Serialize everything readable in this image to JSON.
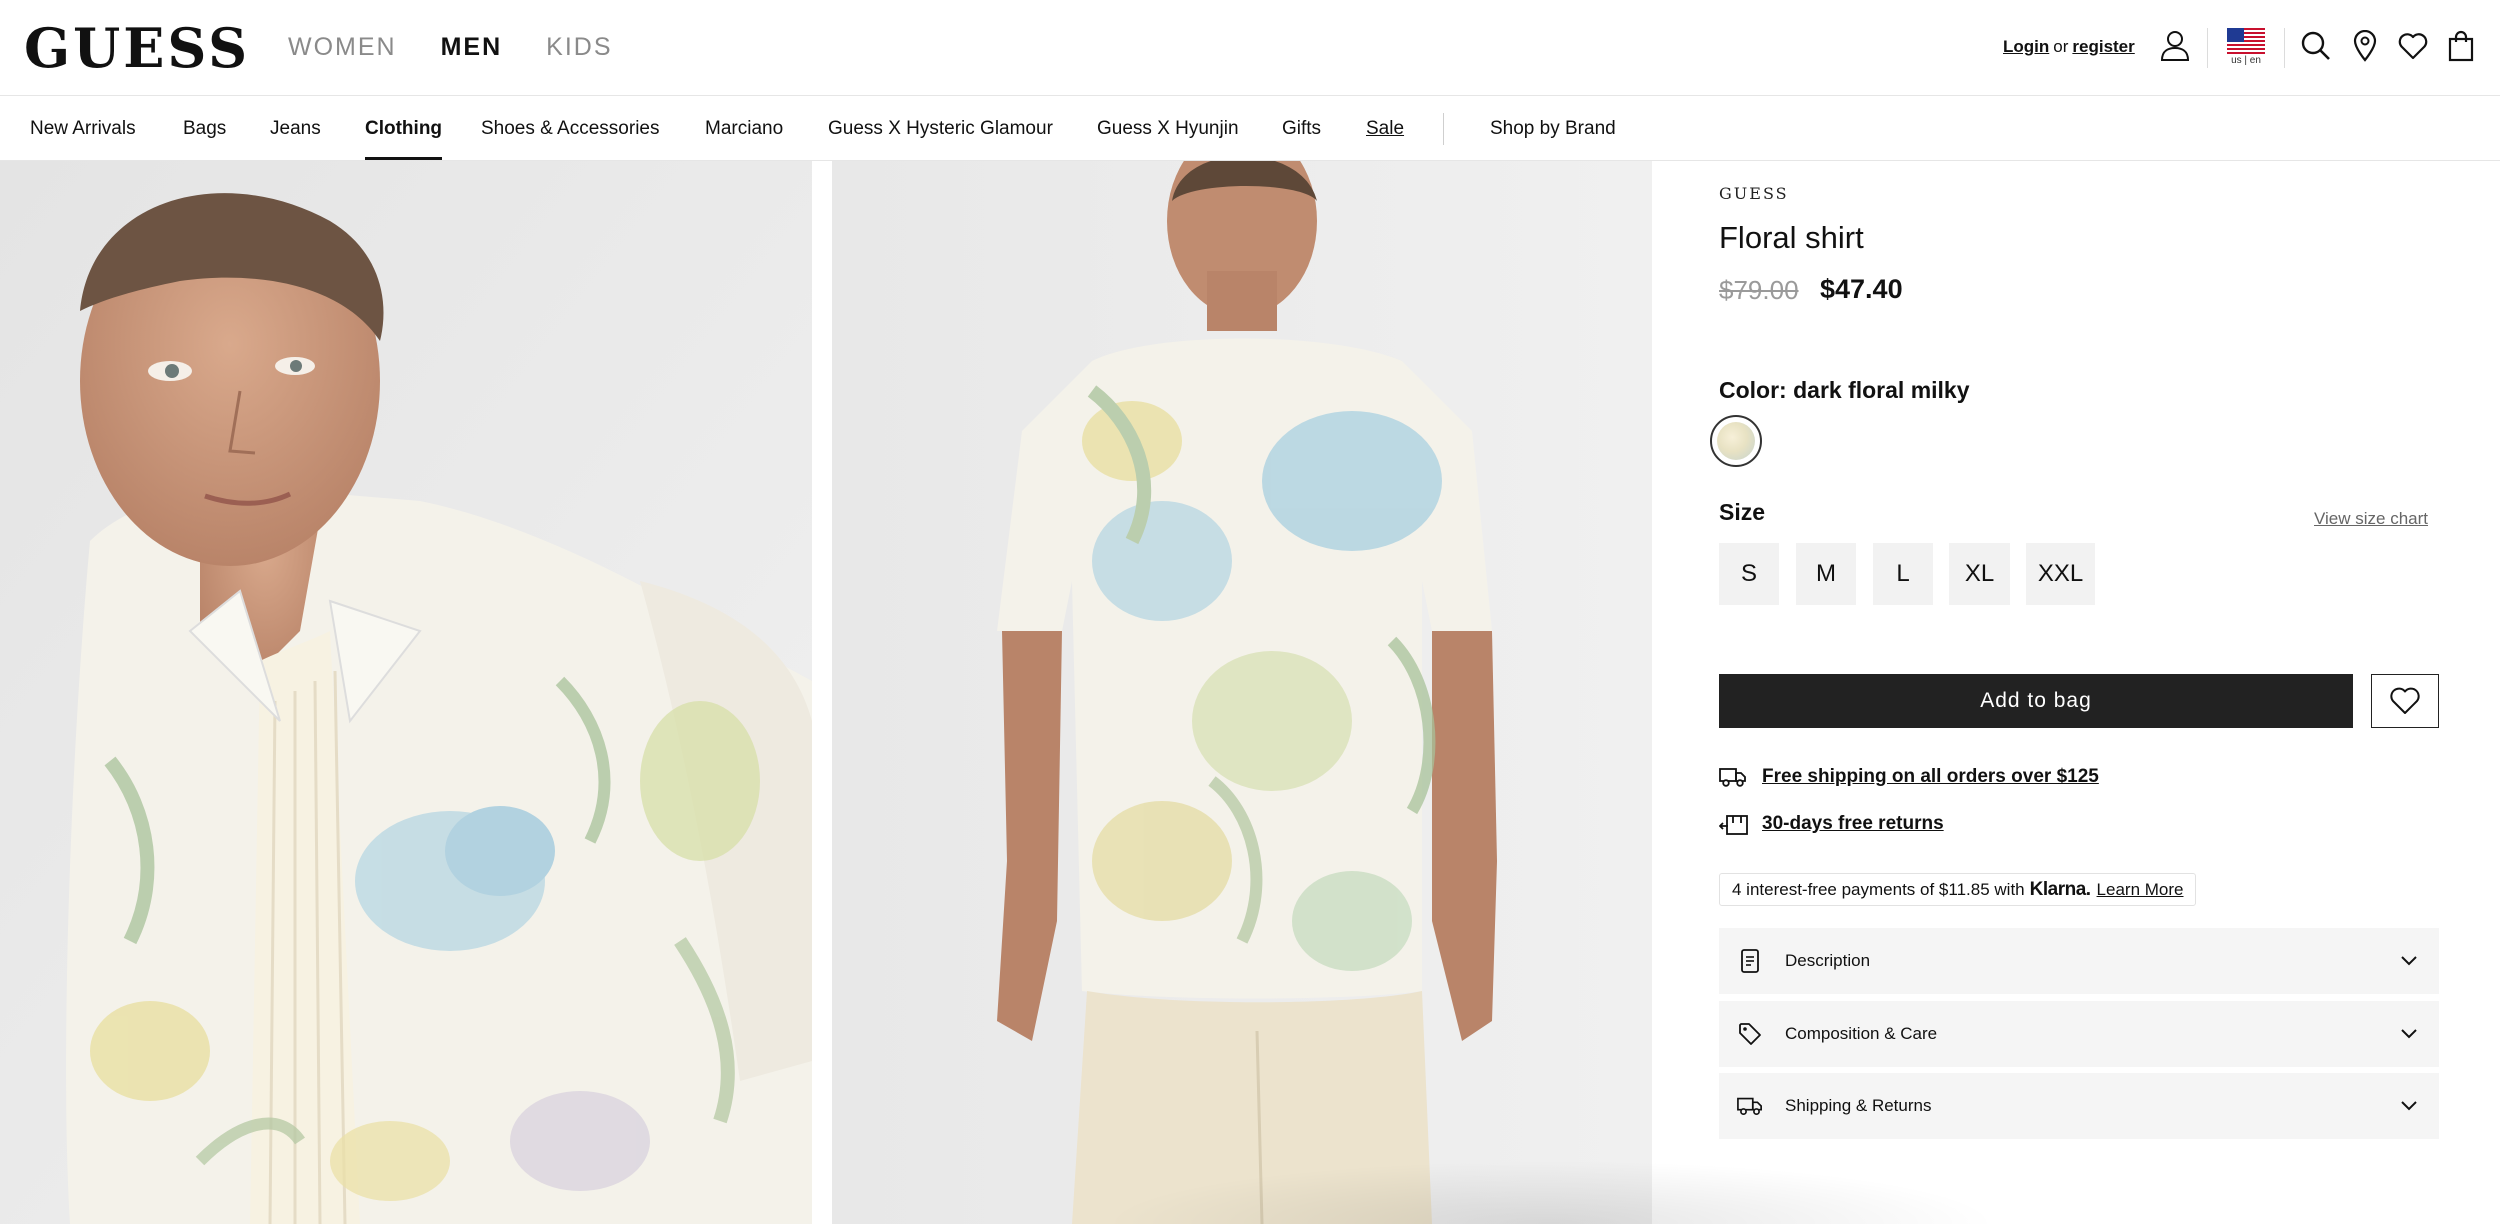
{
  "header": {
    "logo": "GUESS",
    "gender_nav": [
      {
        "label": "WOMEN",
        "active": false
      },
      {
        "label": "MEN",
        "active": true
      },
      {
        "label": "KIDS",
        "active": false
      }
    ],
    "login_label": "Login",
    "or_label": "or",
    "register_label": "register",
    "locale": "us | en",
    "icons": [
      "user-icon",
      "us-flag-icon",
      "search-icon",
      "store-locator-icon",
      "heart-icon",
      "shopping-bag-icon"
    ]
  },
  "category_nav": {
    "items": [
      {
        "label": "New Arrivals"
      },
      {
        "label": "Bags"
      },
      {
        "label": "Jeans"
      },
      {
        "label": "Clothing",
        "active": true
      },
      {
        "label": "Shoes & Accessories"
      },
      {
        "label": "Marciano"
      },
      {
        "label": "Guess X Hysteric Glamour"
      },
      {
        "label": "Guess X Hyunjin"
      },
      {
        "label": "Gifts"
      },
      {
        "label": "Sale",
        "underlined": true
      }
    ],
    "shop_by_brand": "Shop by Brand"
  },
  "product": {
    "brand": "GUESS",
    "title": "Floral shirt",
    "price_original": "$79.00",
    "price_sale": "$47.40",
    "color_label": "Color: dark floral milky",
    "size_label": "Size",
    "size_chart_link": "View size chart",
    "sizes": [
      "S",
      "M",
      "L",
      "XL",
      "XXL"
    ],
    "add_to_bag": "Add to bag",
    "perks": {
      "shipping": "Free shipping on all orders over $125",
      "returns": "30-days free returns"
    },
    "klarna": {
      "text": "4 interest-free payments of $11.85 with",
      "logo": "Klarna.",
      "learn_more": "Learn More"
    },
    "accordions": [
      {
        "label": "Description",
        "icon": "document-icon"
      },
      {
        "label": "Composition & Care",
        "icon": "tag-icon"
      },
      {
        "label": "Shipping & Returns",
        "icon": "truck-icon"
      }
    ]
  },
  "colors": {
    "text": "#111111",
    "muted": "#8a8a8a",
    "button_dark": "#222222",
    "panel_bg": "#f5f5f5"
  }
}
